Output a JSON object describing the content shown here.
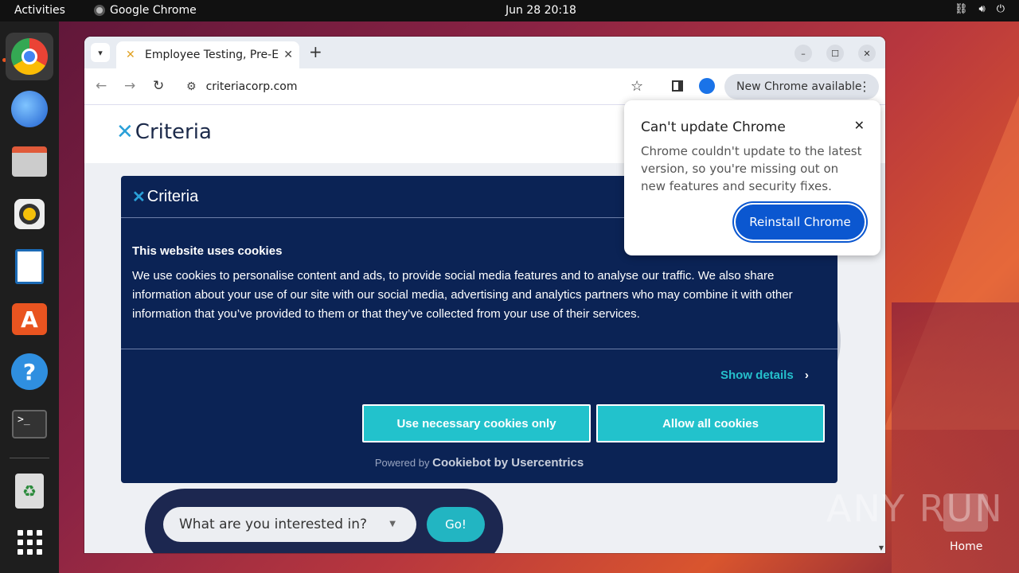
{
  "topbar": {
    "activities": "Activities",
    "app_name": "Google Chrome",
    "clock": "Jun 28  20:18",
    "tray_icons": [
      "network-icon",
      "volume-icon",
      "power-icon"
    ]
  },
  "dock": {
    "items": [
      "chrome",
      "thunderbird",
      "files",
      "rhythmbox",
      "writer",
      "app-center",
      "help",
      "terminal",
      "trash",
      "show-apps"
    ]
  },
  "browser": {
    "tab_title": "Employee Testing, Pre-E",
    "address": "criteriacorp.com",
    "update_chip": "New Chrome available"
  },
  "site": {
    "logo_text": "Criteria",
    "search_placeholder": "What are you interested in?",
    "go_label": "Go!"
  },
  "cookie": {
    "logo_text": "Criteria",
    "heading": "This website uses cookies",
    "body": "We use cookies to personalise content and ads, to provide social media features and to analyse our traffic. We also share information about your use of our site with our social media, advertising and analytics partners who may combine it with other information that you’ve provided to them or that they’ve collected from your use of their services.",
    "show_details": "Show details",
    "necessary_btn": "Use necessary cookies only",
    "allow_btn": "Allow all cookies",
    "powered_prefix": "Powered by",
    "powered_brand": "Cookiebot by Usercentrics"
  },
  "popup": {
    "title": "Can't update Chrome",
    "message": "Chrome couldn't update to the latest version, so you're missing out on new features and security fixes.",
    "button": "Reinstall Chrome"
  },
  "desktop": {
    "watermark": "ANY RUN",
    "home_label": "Home"
  },
  "colors": {
    "cookie_bg": "#0b2355",
    "accent_teal": "#22c2cc",
    "chrome_blue": "#0b57d0"
  }
}
